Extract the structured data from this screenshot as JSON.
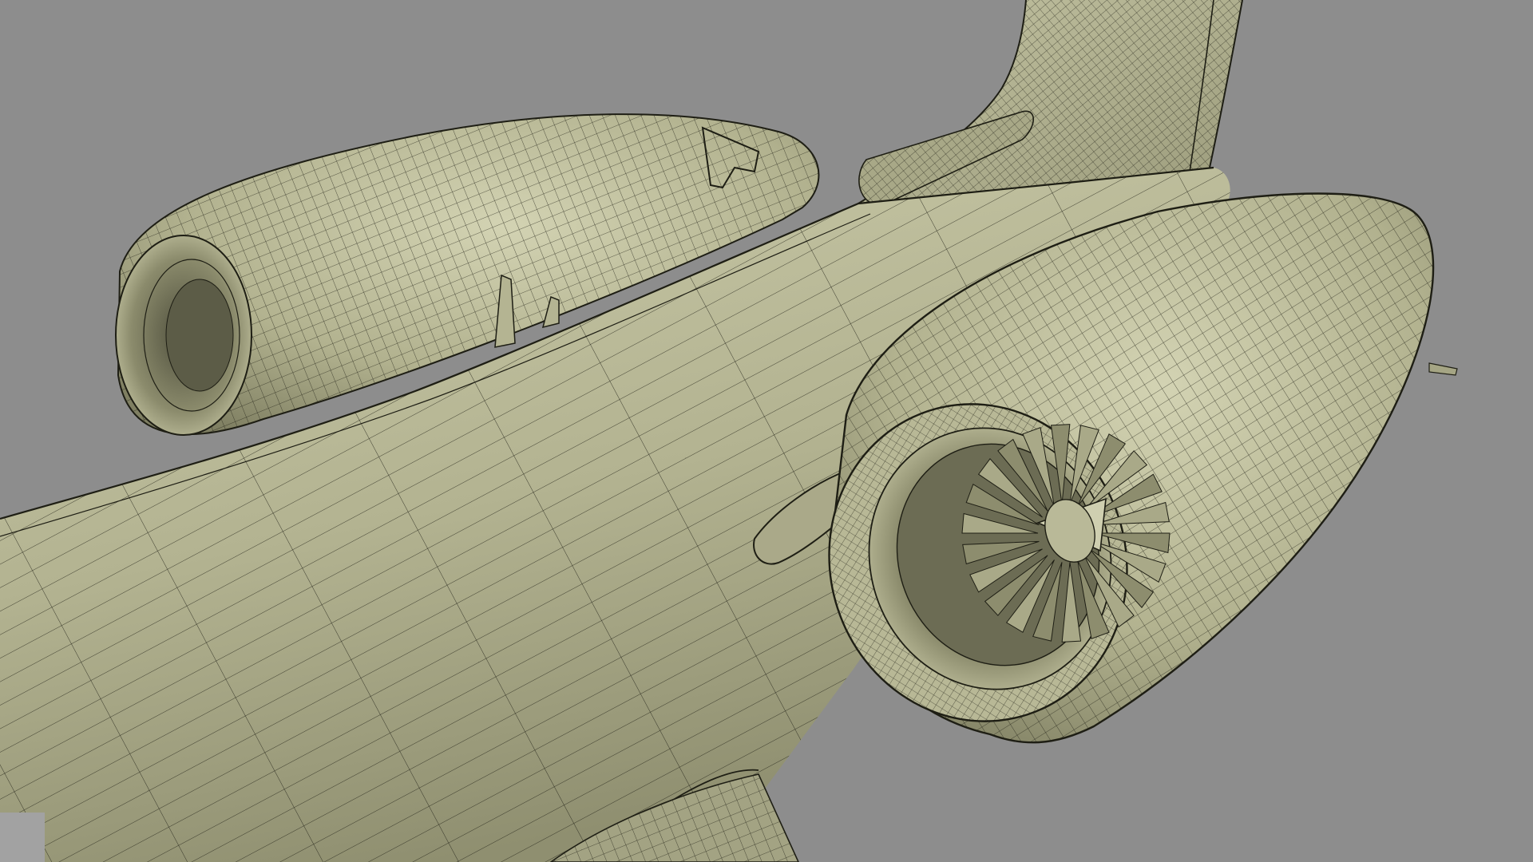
{
  "viewport": {
    "background": "#8d8d8d",
    "surface_fill": "#b6b693",
    "surface_fill_light": "#d2d2b3",
    "surface_fill_dark": "#6e6e55",
    "wire_color": "#1e1e14",
    "corner_swatch_color": "#a2a2a2"
  }
}
